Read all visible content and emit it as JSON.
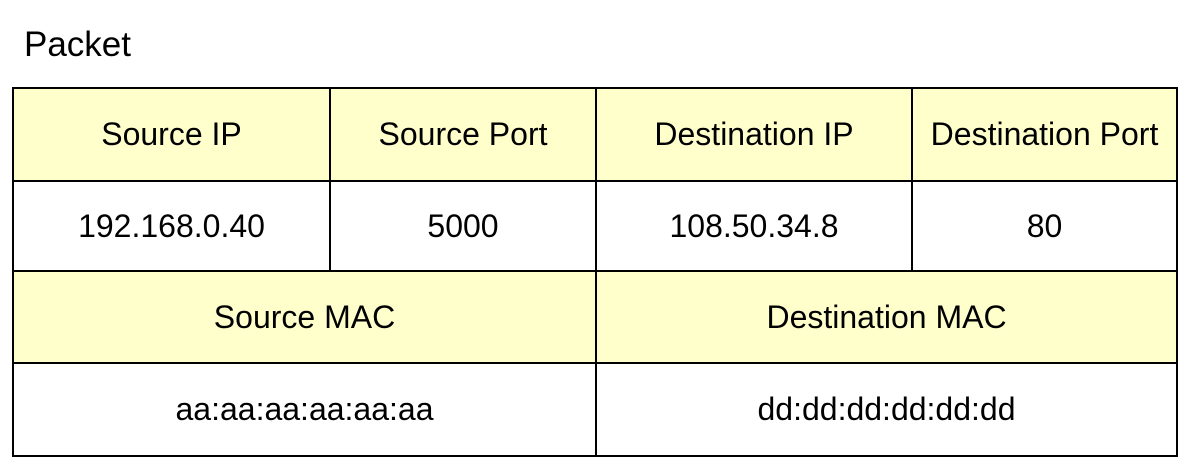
{
  "title": "Packet",
  "colors": {
    "header_fill": "#ffffcc",
    "value_fill": "#ffffff",
    "border": "#000000"
  },
  "transport_row": {
    "headers": [
      "Source IP",
      "Source Port",
      "Destination IP",
      "Destination Port"
    ],
    "values": [
      "192.168.0.40",
      "5000",
      "108.50.34.8",
      "80"
    ]
  },
  "link_row": {
    "headers": [
      "Source MAC",
      "Destination MAC"
    ],
    "values": [
      "aa:aa:aa:aa:aa:aa",
      "dd:dd:dd:dd:dd:dd"
    ]
  }
}
